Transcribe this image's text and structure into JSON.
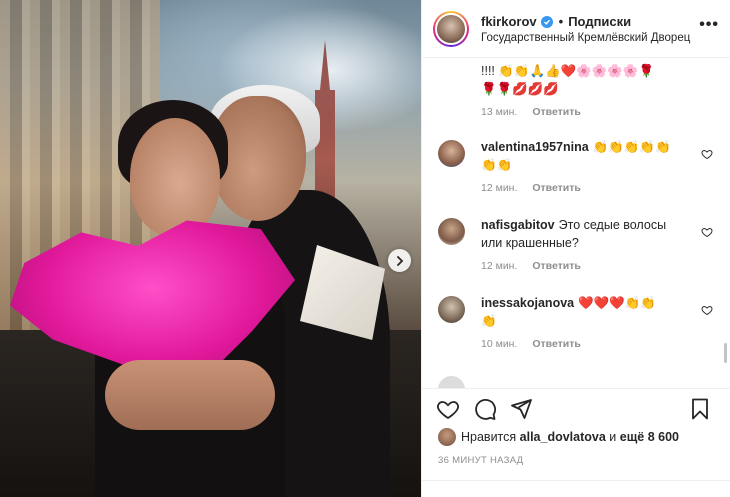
{
  "header": {
    "username": "fkirkorov",
    "separator": "•",
    "follow_label": "Подписки",
    "location": "Государственный Кремлёвский Дворец",
    "more": "•••"
  },
  "comments": [
    {
      "text": "!!!! 👏👏🙏👍❤️🌸🌸🌸🌸🌹\n🌹🌹💋💋💋",
      "time": "13 мин.",
      "reply": "Ответить"
    },
    {
      "user": "valentina1957nina",
      "text": "👏👏👏👏👏\n👏👏",
      "time": "12 мин.",
      "reply": "Ответить"
    },
    {
      "user": "nafisgabitov",
      "text": "Это седые волосы или крашенные?",
      "time": "12 мин.",
      "reply": "Ответить"
    },
    {
      "user": "inessakojanova",
      "text": "❤️❤️❤️👏👏\n👏",
      "time": "10 мин.",
      "reply": "Ответить"
    }
  ],
  "likes": {
    "prefix": "Нравится",
    "user": "alla_dovlatova",
    "middle": "и",
    "rest": "ещё 8 600"
  },
  "timestamp": "36 МИНУТ НАЗАД",
  "icons": {
    "like": "heart-icon",
    "comment": "comment-icon",
    "share": "paper-plane-icon",
    "save": "bookmark-icon",
    "next": "chevron-right-icon"
  },
  "colors": {
    "verified": "#3897f0",
    "meta_gray": "#8e8e8e"
  }
}
